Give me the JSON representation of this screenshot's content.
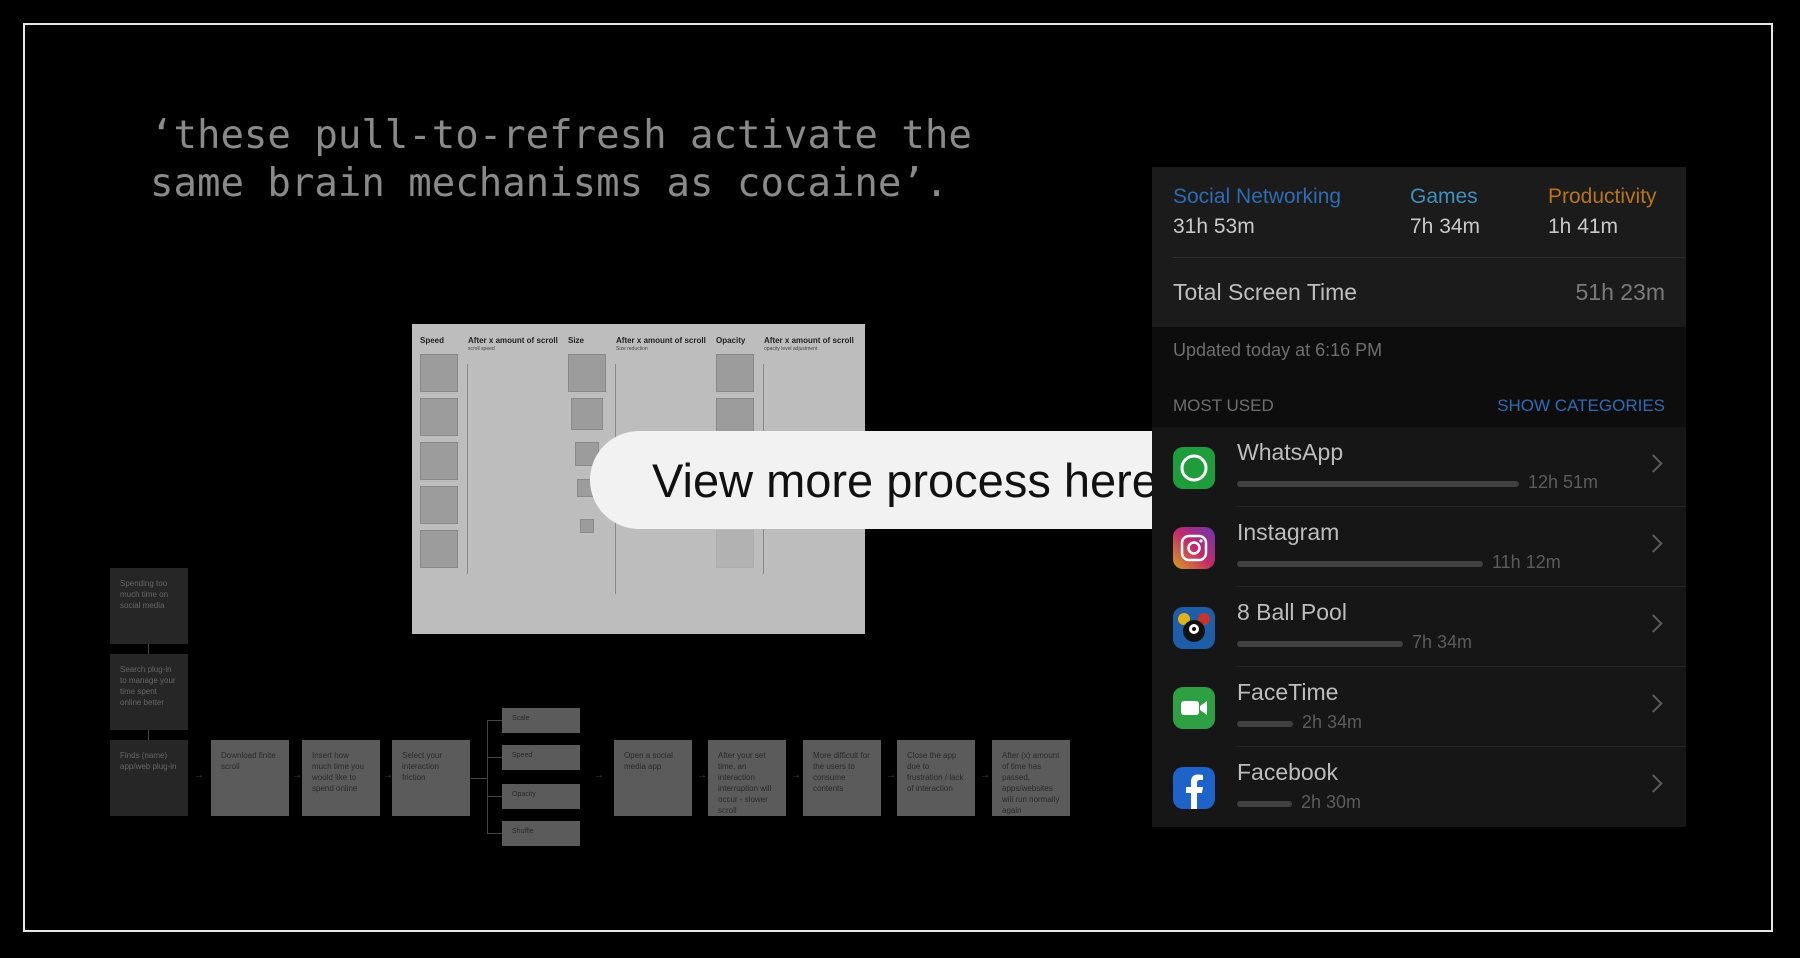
{
  "quote": "‘these pull-to-refresh activate the same brain mechanisms as cocaine’.",
  "cta": {
    "label": "View more process here"
  },
  "process_image": {
    "columns": [
      "Speed",
      "After x amount of scroll",
      "Size",
      "After x amount of scroll",
      "Opacity",
      "After x amount of scroll"
    ],
    "subheads": [
      "scroll speed",
      "Size reduction",
      "opacity level adjustment"
    ]
  },
  "flow": {
    "left_column": [
      "Spending too much time on social media",
      "Search plug-in to manage your time spent online better",
      "Finds (name) app/web plug-in"
    ],
    "steps": [
      "Download finite scroll",
      "Insert how much time you would like to spend online",
      "Select your interaction friction"
    ],
    "options": [
      "Scale",
      "Speed",
      "Opacity",
      "Shuffle"
    ],
    "after_steps": [
      "Open a social media app",
      "After your set time, an interaction interruption will occur - slower scroll",
      "More difficult for the users to consume contents",
      "Close the app due to frustration / lack of interaction",
      "After (x) amount of time has passed, apps/websites will run normally again"
    ]
  },
  "screen_time": {
    "categories": [
      {
        "name": "Social Networking",
        "time": "31h 53m",
        "color": "#2f6bb3"
      },
      {
        "name": "Games",
        "time": "7h 34m",
        "color": "#3f8fbf"
      },
      {
        "name": "Productivity",
        "time": "1h 41m",
        "color": "#b8741a"
      }
    ],
    "total_label": "Total Screen Time",
    "total_value": "51h 23m",
    "updated": "Updated today at 6:16 PM",
    "most_used_label": "MOST USED",
    "show_categories_label": "SHOW CATEGORIES",
    "apps": [
      {
        "name": "WhatsApp",
        "time": "12h 51m",
        "minutes": 771,
        "icon": "whatsapp-icon"
      },
      {
        "name": "Instagram",
        "time": "11h 12m",
        "minutes": 672,
        "icon": "instagram-icon"
      },
      {
        "name": "8 Ball Pool",
        "time": "7h 34m",
        "minutes": 454,
        "icon": "eight-ball-pool-icon"
      },
      {
        "name": "FaceTime",
        "time": "2h 34m",
        "minutes": 154,
        "icon": "facetime-icon"
      },
      {
        "name": "Facebook",
        "time": "2h 30m",
        "minutes": 150,
        "icon": "facebook-icon"
      }
    ]
  }
}
